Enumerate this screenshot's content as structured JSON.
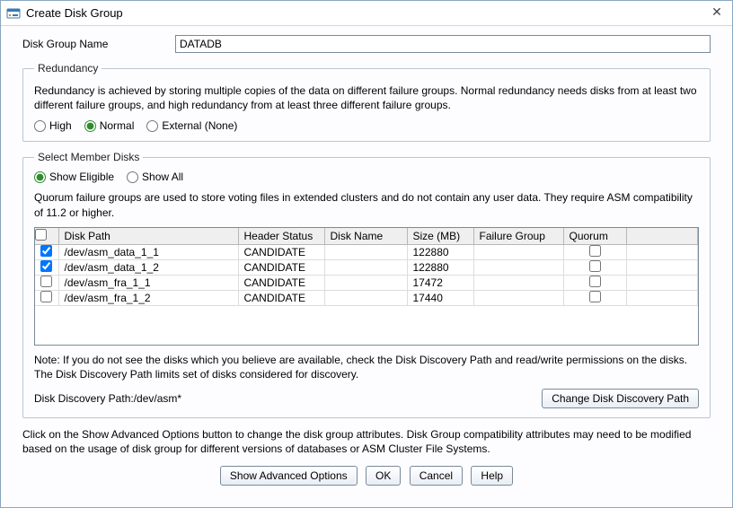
{
  "window": {
    "title": "Create Disk Group"
  },
  "diskGroupName": {
    "label": "Disk Group Name",
    "value": "DATADB"
  },
  "redundancy": {
    "legend": "Redundancy",
    "help": "Redundancy is achieved by storing multiple copies of the data on different failure groups. Normal redundancy needs disks from at least two different failure groups, and high redundancy from at least three different failure groups.",
    "options": {
      "high": "High",
      "normal": "Normal",
      "external": "External (None)"
    },
    "selected": "normal"
  },
  "memberDisks": {
    "legend": "Select Member Disks",
    "filter": {
      "eligible": "Show Eligible",
      "all": "Show All",
      "selected": "eligible"
    },
    "quorumHelp": "Quorum failure groups are used to store voting files in extended clusters and do not contain any user data. They require ASM compatibility of 11.2 or higher.",
    "columns": {
      "path": "Disk Path",
      "header": "Header Status",
      "name": "Disk Name",
      "size": "Size (MB)",
      "fg": "Failure Group",
      "quorum": "Quorum"
    },
    "rows": [
      {
        "selected": true,
        "path": "/dev/asm_data_1_1",
        "header": "CANDIDATE",
        "name": "",
        "size": "122880",
        "fg": "",
        "quorum": false
      },
      {
        "selected": true,
        "path": "/dev/asm_data_1_2",
        "header": "CANDIDATE",
        "name": "",
        "size": "122880",
        "fg": "",
        "quorum": false
      },
      {
        "selected": false,
        "path": "/dev/asm_fra_1_1",
        "header": "CANDIDATE",
        "name": "",
        "size": "17472",
        "fg": "",
        "quorum": false
      },
      {
        "selected": false,
        "path": "/dev/asm_fra_1_2",
        "header": "CANDIDATE",
        "name": "",
        "size": "17440",
        "fg": "",
        "quorum": false
      }
    ],
    "note": "Note: If you do not see the disks which you believe are available, check the Disk Discovery Path and read/write permissions on the disks. The Disk Discovery Path limits set of disks considered for discovery.",
    "discoveryPathLabel": "Disk Discovery Path:",
    "discoveryPathValue": "/dev/asm*",
    "changeDiscoveryBtn": "Change Disk Discovery Path"
  },
  "advancedNote": "Click on the Show Advanced Options button to change the disk group attributes. Disk Group compatibility attributes may need to be modified based on the usage of disk group for different versions of databases or ASM Cluster File Systems.",
  "buttons": {
    "advanced": "Show Advanced Options",
    "ok": "OK",
    "cancel": "Cancel",
    "help": "Help"
  }
}
